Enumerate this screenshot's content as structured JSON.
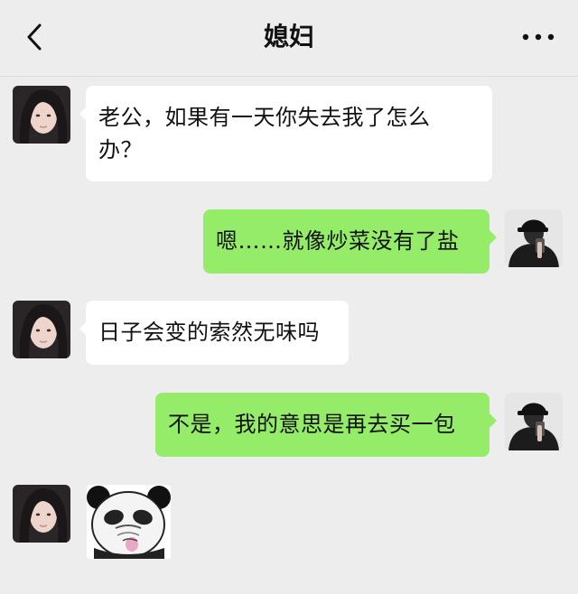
{
  "header": {
    "title": "媳妇"
  },
  "messages": [
    {
      "sender": "wife",
      "text": "老公，如果有一天你失去我了怎么办？"
    },
    {
      "sender": "me",
      "text": "嗯……就像炒菜没有了盐"
    },
    {
      "sender": "wife",
      "text": "日子会变的索然无味吗"
    },
    {
      "sender": "me",
      "text": "不是，我的意思是再去买一包"
    },
    {
      "sender": "wife",
      "type": "sticker",
      "sticker": "panda-meme"
    }
  ],
  "colors": {
    "background": "#ededed",
    "bubble_incoming": "#ffffff",
    "bubble_outgoing": "#95ec69"
  }
}
